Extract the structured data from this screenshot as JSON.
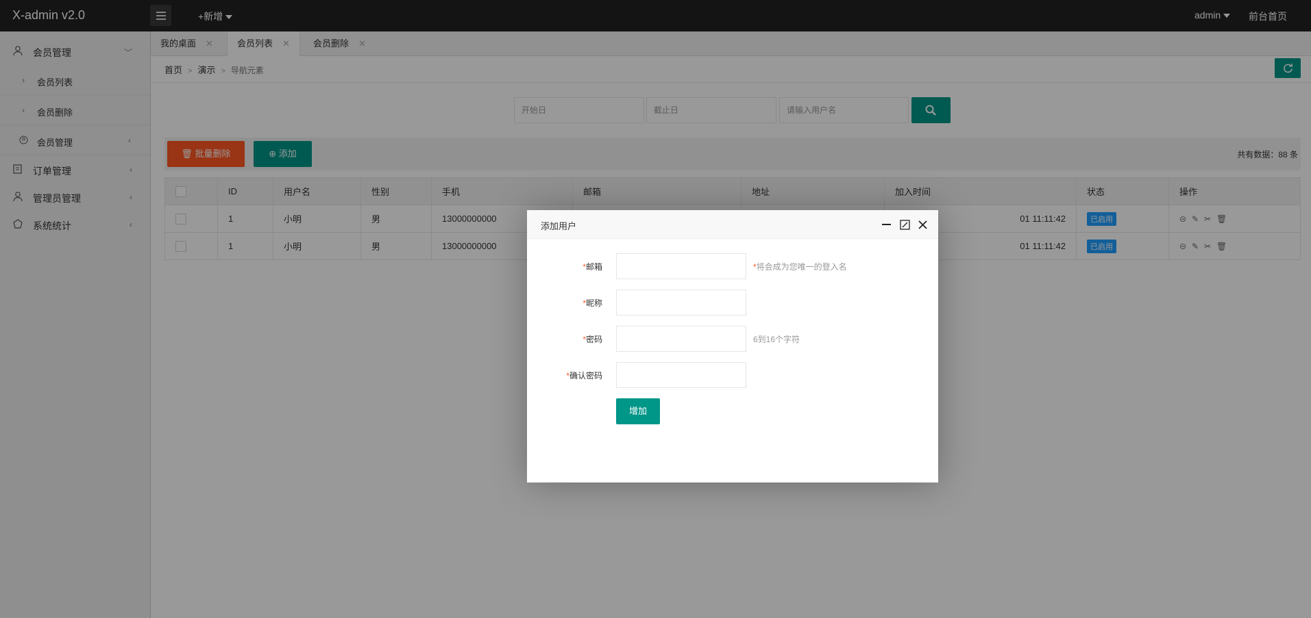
{
  "app": {
    "title": "X-admin v2.0"
  },
  "header": {
    "new_label": "+新增",
    "user": "admin",
    "home_link": "前台首页"
  },
  "sidebar": {
    "groups": [
      {
        "label": "会员管理",
        "arrow": "expanded",
        "icon": "user-icon"
      },
      {
        "label": "订单管理",
        "arrow": "collapsed",
        "icon": "order-icon"
      },
      {
        "label": "管理员管理",
        "arrow": "collapsed",
        "icon": "admin-icon"
      },
      {
        "label": "系统统计",
        "arrow": "collapsed",
        "icon": "stats-icon"
      }
    ],
    "subitems": [
      {
        "label": "会员列表"
      },
      {
        "label": "会员删除"
      },
      {
        "label": "会员管理"
      }
    ]
  },
  "tabs": [
    {
      "label": "我的桌面",
      "close": "✕"
    },
    {
      "label": "会员列表",
      "close": "✕",
      "active": true
    },
    {
      "label": "会员删除",
      "close": "✕"
    }
  ],
  "breadcrumb": {
    "items": [
      "首页",
      "演示"
    ],
    "current": "导航元素",
    "separator": ">"
  },
  "search": {
    "start_placeholder": "开始日",
    "end_placeholder": "截止日",
    "username_placeholder": "请输入用户名"
  },
  "toolbar": {
    "batch_delete": "批量删除",
    "add": "添加",
    "total": "共有数据：88 条"
  },
  "table": {
    "columns": [
      "ID",
      "用户名",
      "性别",
      "手机",
      "邮箱",
      "地址",
      "加入时间",
      "状态",
      "操作"
    ],
    "rows": [
      {
        "id": "1",
        "username": "小明",
        "gender": "男",
        "phone": "13000000000",
        "email": "",
        "address": "",
        "join_time": "01 11:11:42",
        "status": "已启用"
      },
      {
        "id": "1",
        "username": "小明",
        "gender": "男",
        "phone": "13000000000",
        "email": "",
        "address": "",
        "join_time": "01 11:11:42",
        "status": "已启用"
      }
    ]
  },
  "modal": {
    "title": "添加用户",
    "fields": [
      {
        "label": "邮箱",
        "tip": "将会成为您唯一的登入名",
        "tip_required": true
      },
      {
        "label": "昵称",
        "tip": ""
      },
      {
        "label": "密码",
        "tip": "6到16个字符"
      },
      {
        "label": "确认密码",
        "tip": ""
      }
    ],
    "submit": "增加"
  },
  "colors": {
    "accent": "#009688",
    "danger": "#ff5722",
    "badge": "#1E9FFF",
    "topbar": "#222222"
  }
}
